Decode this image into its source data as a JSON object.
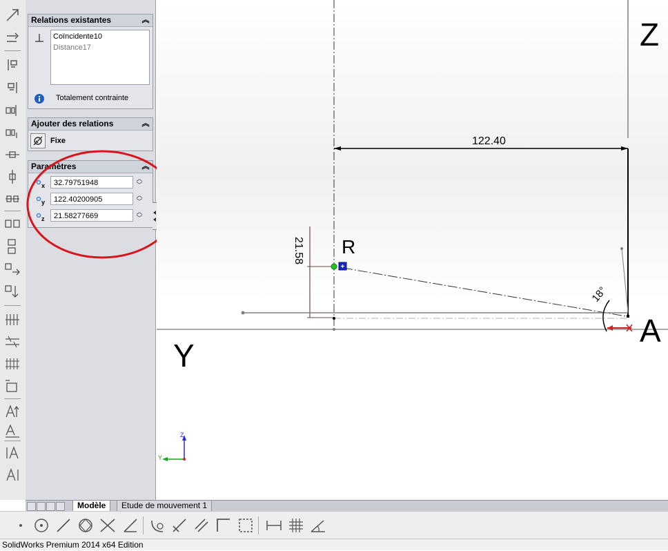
{
  "relations_group": {
    "title": "Relations existantes",
    "items": [
      "Coïncidente10",
      "Distance17"
    ],
    "status": "Totalement contrainte"
  },
  "add_relations_group": {
    "title": "Ajouter des relations",
    "fix_label": "Fixe"
  },
  "parameters_group": {
    "title": "Paramètres",
    "x_value": "32.79751948",
    "y_value": "122.40200905",
    "z_value": "21.58277669",
    "x_axis": "x",
    "y_axis": "y",
    "z_axis": "z"
  },
  "canvas": {
    "label_z": "Z",
    "label_y": "Y",
    "label_a": "A",
    "label_r": "R",
    "dim_horizontal": "122.40",
    "dim_vertical": "21.58",
    "dim_angle": "18°",
    "triad_z": "Z",
    "triad_y": "Y"
  },
  "tabs": [
    "Modèle",
    "Etude de mouvement 1"
  ],
  "status_bar": "SolidWorks Premium 2014 x64 Edition",
  "colors": {
    "annotation_circle": "#d9141c",
    "point_green": "#1ec81e",
    "point_blue": "#1428c8",
    "triad_z": "#2a2ad0",
    "triad_y": "#20a020"
  },
  "icons": {
    "left_toolstrip": [
      "relation-icon",
      "parallel-icon",
      "align-icon",
      "align-icon",
      "coincident-icon",
      "coincident-icon",
      "midpoint-icon",
      "midpoint-icon",
      "pattern-icon",
      "pattern-icon",
      "pattern-icon",
      "pattern-icon",
      "grid-icon",
      "grid-icon",
      "grid-icon",
      "grid-icon",
      "text-icon",
      "text-icon",
      "text-icon",
      "text-icon"
    ],
    "sketch_toolbar": [
      "point-icon",
      "circle-icon",
      "line-icon",
      "polygon-icon",
      "trim-icon",
      "line-icon",
      "arc-icon",
      "trim-icon",
      "parallel-icon",
      "corner-icon",
      "rectangle-icon",
      "dimension-icon",
      "grid-icon",
      "angle-icon"
    ]
  }
}
